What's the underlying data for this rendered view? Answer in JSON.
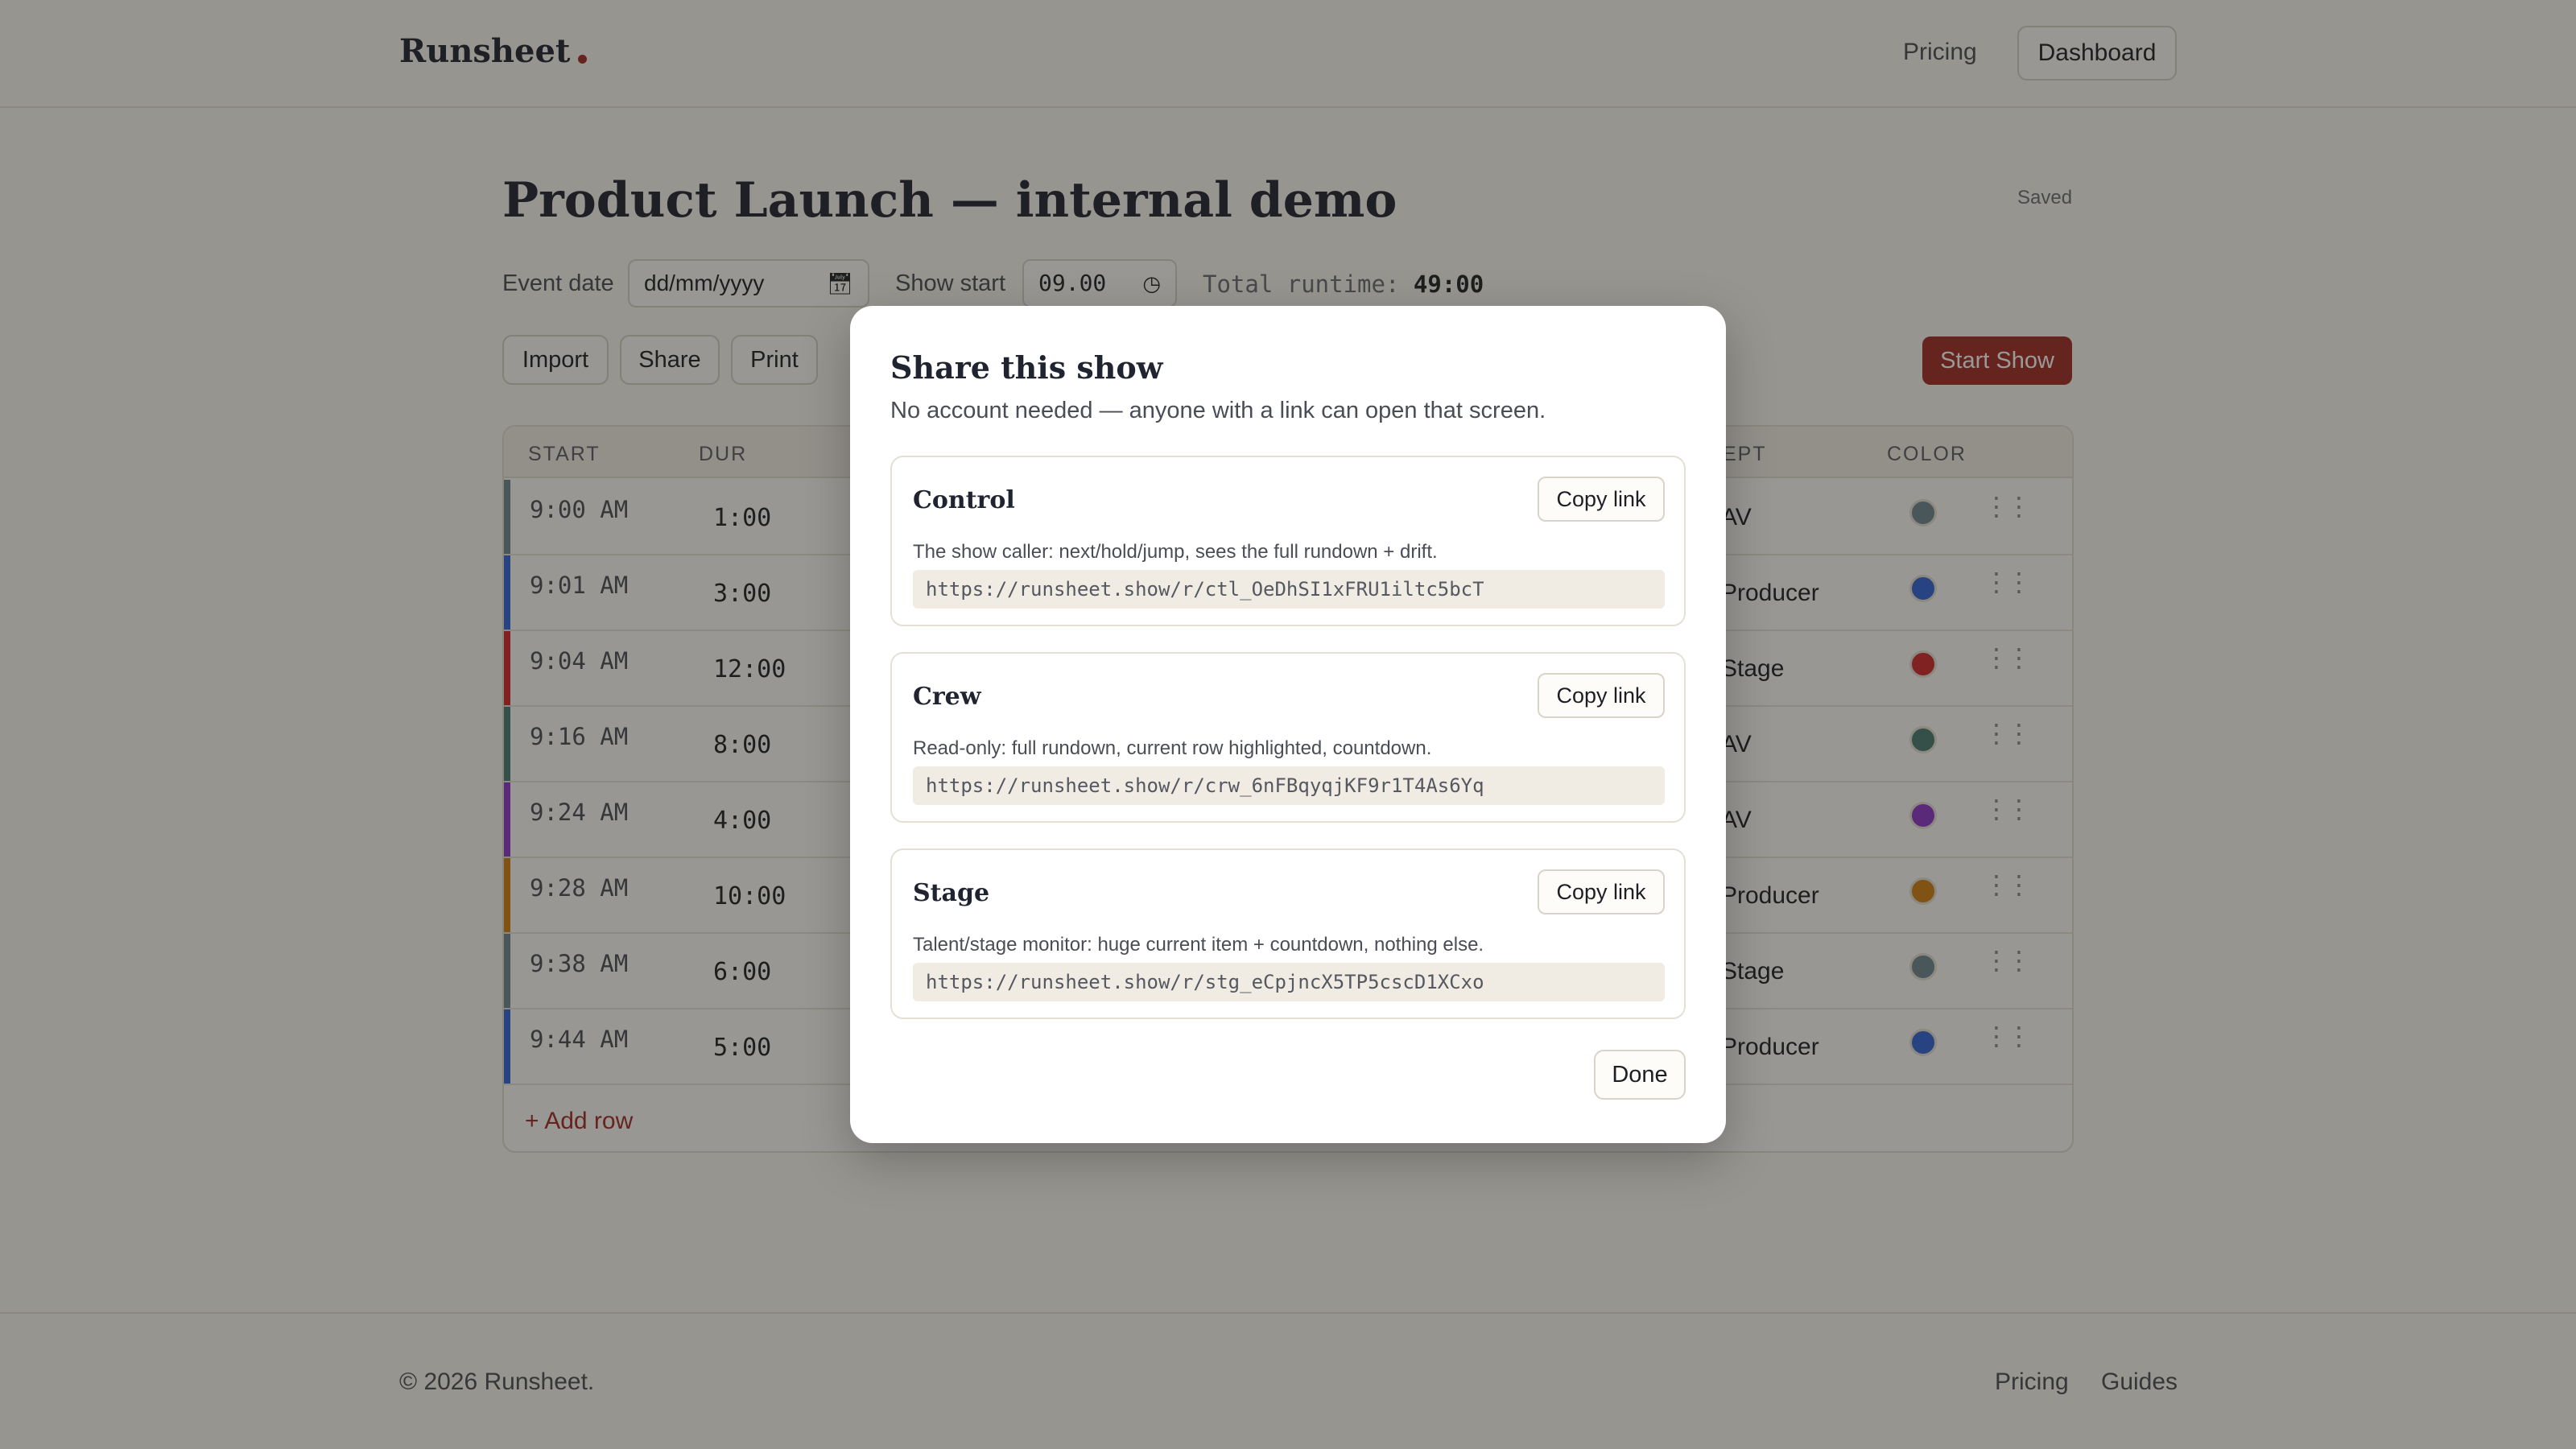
{
  "header": {
    "logo": "Runsheet",
    "nav": {
      "pricing": "Pricing",
      "dashboard": "Dashboard"
    }
  },
  "page": {
    "title": "Product Launch — internal demo",
    "save_status": "Saved",
    "event_date_label": "Event date",
    "event_date_placeholder": "dd/mm/yyyy",
    "show_start_label": "Show start",
    "show_start_value": "09.00",
    "runtime_label": "Total runtime:",
    "runtime_value": "49:00"
  },
  "toolbar": {
    "import": "Import",
    "share": "Share",
    "print": "Print",
    "start_show": "Start Show"
  },
  "table": {
    "headers": {
      "start": "START",
      "dur": "DUR",
      "dept": "EPT",
      "color": "COLOR"
    },
    "rows": [
      {
        "start": "9:00 AM",
        "dur": "1:00",
        "dept": "AV",
        "color": "#6c8793"
      },
      {
        "start": "9:01 AM",
        "dur": "3:00",
        "dept": "Producer",
        "color": "#2f63d8"
      },
      {
        "start": "9:04 AM",
        "dur": "12:00",
        "dept": "Stage",
        "color": "#d0262a"
      },
      {
        "start": "9:16 AM",
        "dur": "8:00",
        "dept": "AV",
        "color": "#467a70"
      },
      {
        "start": "9:24 AM",
        "dur": "4:00",
        "dept": "AV",
        "color": "#8a33c8"
      },
      {
        "start": "9:28 AM",
        "dur": "10:00",
        "dept": "Producer",
        "color": "#d07e10"
      },
      {
        "start": "9:38 AM",
        "dur": "6:00",
        "dept": "Stage",
        "color": "#6c8793"
      },
      {
        "start": "9:44 AM",
        "dur": "5:00",
        "dept": "Producer",
        "color": "#2f63d8"
      }
    ],
    "add_row": "+ Add row"
  },
  "footer": {
    "copyright": "© 2026 Runsheet.",
    "pricing": "Pricing",
    "guides": "Guides"
  },
  "modal": {
    "title": "Share this show",
    "subtitle": "No account needed — anyone with a link can open that screen.",
    "cards": [
      {
        "title": "Control",
        "copy": "Copy link",
        "desc": "The show caller: next/hold/jump, sees the full rundown + drift.",
        "url": "https://runsheet.show/r/ctl_OeDhSI1xFRU1iltc5bcT"
      },
      {
        "title": "Crew",
        "copy": "Copy link",
        "desc": "Read-only: full rundown, current row highlighted, countdown.",
        "url": "https://runsheet.show/r/crw_6nFBqyqjKF9r1T4As6Yq"
      },
      {
        "title": "Stage",
        "copy": "Copy link",
        "desc": "Talent/stage monitor: huge current item + countdown, nothing else.",
        "url": "https://runsheet.show/r/stg_eCpjncX5TP5cscD1XCxo"
      }
    ],
    "done": "Done"
  }
}
